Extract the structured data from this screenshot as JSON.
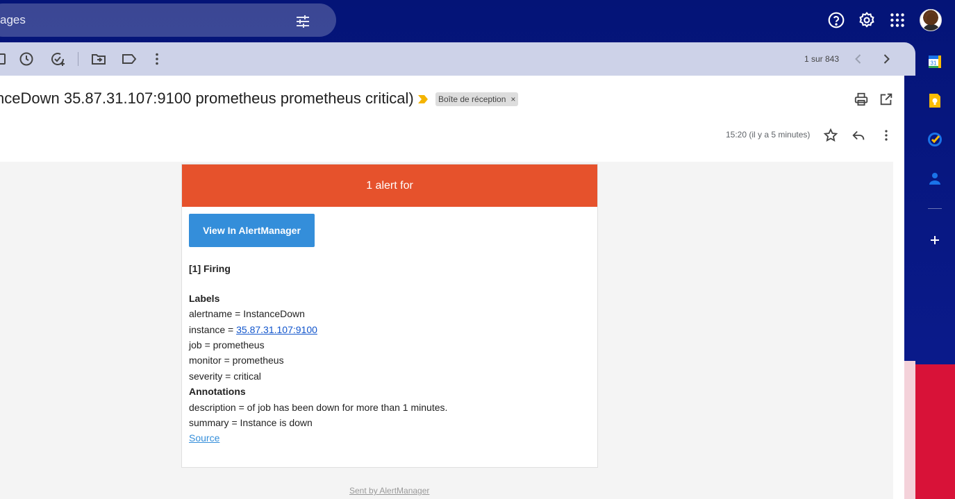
{
  "search": {
    "text": "ages"
  },
  "toolbar": {
    "pager": "1 sur 843"
  },
  "message": {
    "subject": "nceDown 35.87.31.107:9100 prometheus prometheus critical)",
    "label_chip": "Boîte de réception",
    "chip_close": "×",
    "time": "15:20 (il y a 5 minutes)"
  },
  "alert": {
    "header": "1 alert for",
    "button": "View In AlertManager",
    "firing": "[1] Firing",
    "labels_title": "Labels",
    "alertname": "alertname = InstanceDown",
    "instance_prefix": "instance = ",
    "instance_link": "35.87.31.107:9100",
    "job": "job = prometheus",
    "monitor": "monitor = prometheus",
    "severity": "severity = critical",
    "annotations_title": "Annotations",
    "description": "description = of job has been down for more than 1 minutes.",
    "summary": "summary = Instance is down",
    "source": "Source",
    "footer": "Sent by AlertManager"
  },
  "side_panel": {
    "calendar_day": "31"
  },
  "colors": {
    "topbar": "#041477",
    "toolbar": "#cdd2e8",
    "alert_header": "#e6522c",
    "button": "#348eda",
    "red_band": "#d81238"
  }
}
